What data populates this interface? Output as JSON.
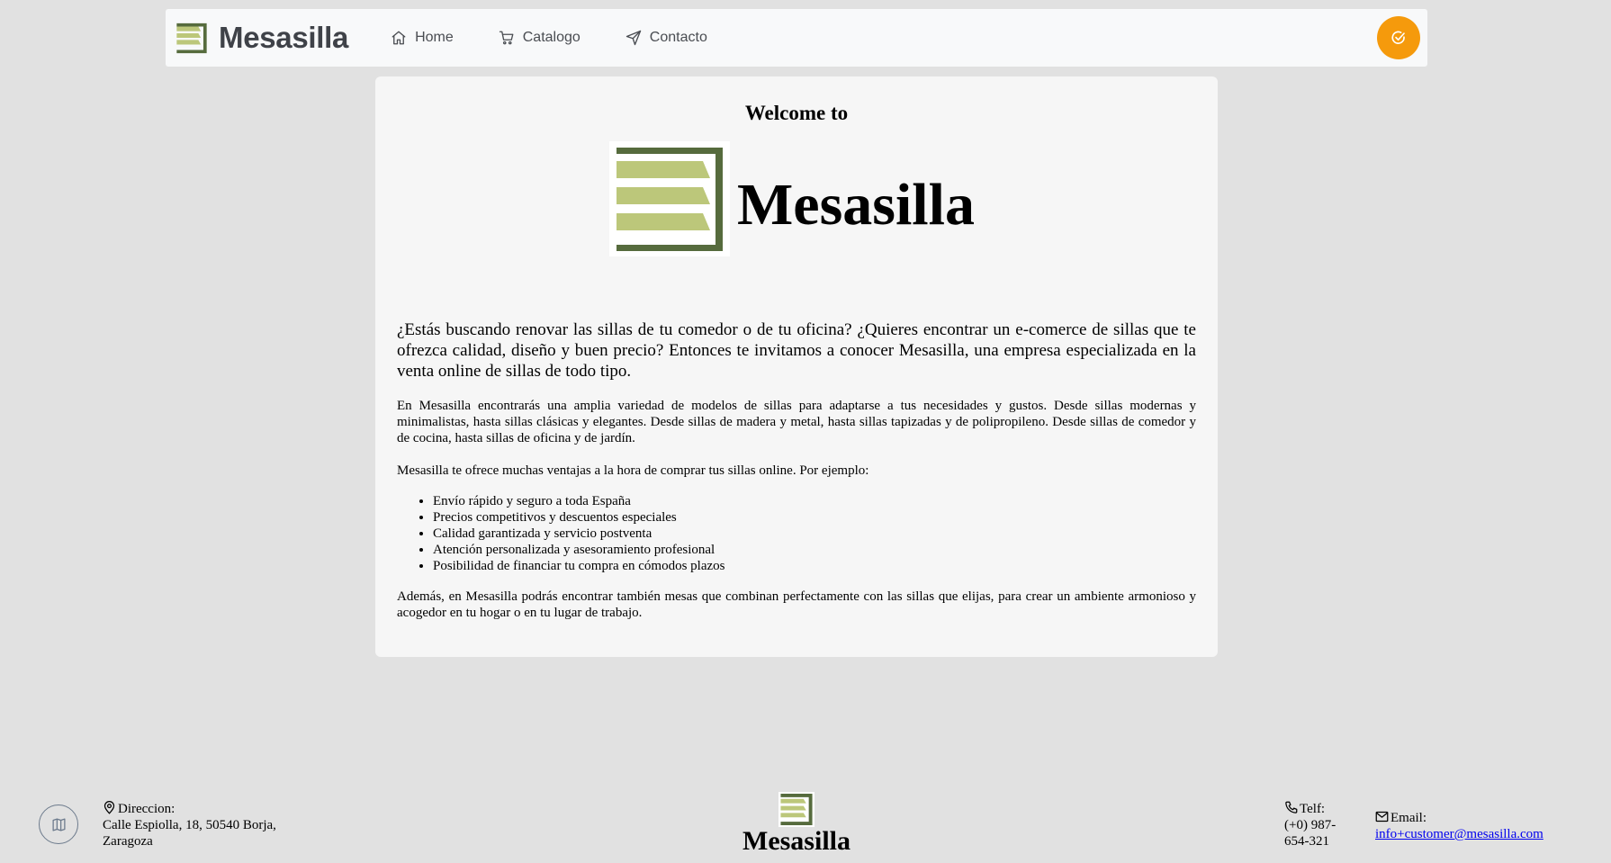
{
  "colors": {
    "logo_dark": "#566b3d",
    "logo_light": "#bcc77a",
    "accent": "#f59a0c",
    "background": "#e1e1e1"
  },
  "navbar": {
    "brand": "Mesasilla",
    "links": [
      {
        "label": "Home",
        "icon": "home-icon"
      },
      {
        "label": "Catalogo",
        "icon": "cart-icon"
      },
      {
        "label": "Contacto",
        "icon": "send-icon"
      }
    ],
    "action_icon": "check-circle-icon"
  },
  "main": {
    "welcome": "Welcome to",
    "logo_text": "Mesasilla",
    "intro": "¿Estás buscando renovar las sillas de tu comedor o de tu oficina? ¿Quieres encontrar un e-comerce de sillas que te ofrezca calidad, diseño y buen precio? Entonces te invitamos a conocer Mesasilla, una empresa especializada en la venta online de sillas de todo tipo.",
    "paragraph1": "En Mesasilla encontrarás una amplia variedad de modelos de sillas para adaptarse a tus necesidades y gustos. Desde sillas modernas y minimalistas, hasta sillas clásicas y elegantes. Desde sillas de madera y metal, hasta sillas tapizadas y de polipropileno. Desde sillas de comedor y de cocina, hasta sillas de oficina y de jardín.",
    "paragraph2": "Mesasilla te ofrece muchas ventajas a la hora de comprar tus sillas online. Por ejemplo:",
    "benefits": [
      "Envío rápido y seguro a toda España",
      "Precios competitivos y descuentos especiales",
      "Calidad garantizada y servicio postventa",
      "Atención personalizada y asesoramiento profesional",
      "Posibilidad de financiar tu compra en cómodos plazos"
    ],
    "paragraph3": "Además, en Mesasilla podrás encontrar también mesas que combinan perfectamente con las sillas que elijas, para crear un ambiente armonioso y acogedor en tu hogar o en tu lugar de trabajo."
  },
  "footer": {
    "map_icon": "map-icon",
    "address_label": "Direccion:",
    "address_value": "Calle Espiolla, 18, 50540 Borja, Zaragoza",
    "logo_text": "Mesasilla",
    "phone_label": "Telf:",
    "phone_value": "(+0) 987-654-321",
    "email_label": "Email:",
    "email_value": "info+customer@mesasilla.com"
  }
}
